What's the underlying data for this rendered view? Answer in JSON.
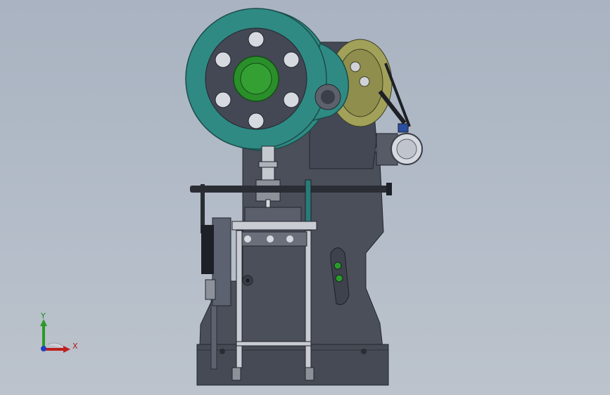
{
  "viewport": {
    "background_top": "#a9b3c1",
    "background_bottom": "#bcc3cc"
  },
  "model": {
    "frame_color": "#4a4f5a",
    "flywheel_color": "#2f8a84",
    "clutch_color": "#2a8f2a",
    "pulley_color": "#a2a15a"
  },
  "triad": {
    "x_label": "X",
    "y_label": "Y",
    "x_color": "#c0201f",
    "y_color": "#2a9a2a",
    "z_color": "#1f3fbf"
  }
}
